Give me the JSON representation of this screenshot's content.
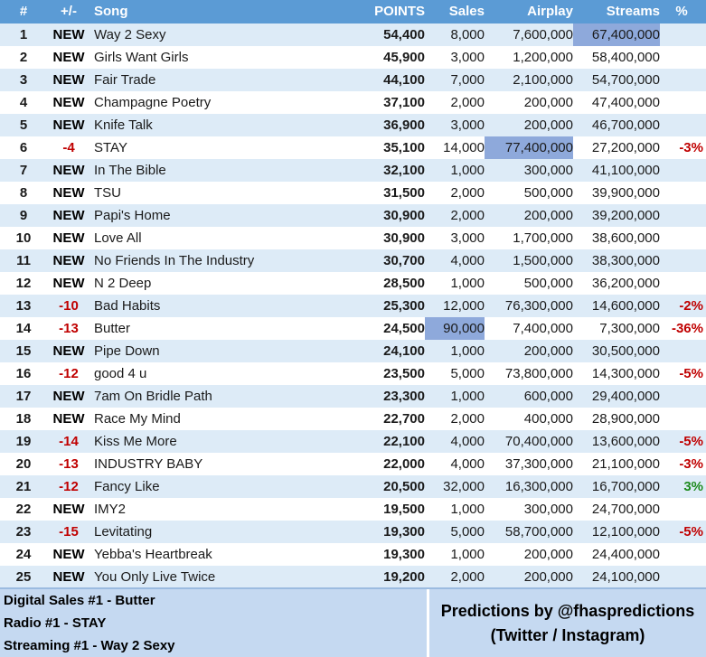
{
  "header": {
    "rank": "#",
    "move": "+/-",
    "song": "Song",
    "points": "POINTS",
    "sales": "Sales",
    "airplay": "Airplay",
    "streams": "Streams",
    "pct": "%"
  },
  "rows": [
    {
      "rank": "1",
      "move": "NEW",
      "song": "Way 2 Sexy",
      "points": "54,400",
      "sales": "8,000",
      "airplay": "7,600,000",
      "streams": "67,400,000",
      "pct": "",
      "hl": "streams"
    },
    {
      "rank": "2",
      "move": "NEW",
      "song": "Girls Want Girls",
      "points": "45,900",
      "sales": "3,000",
      "airplay": "1,200,000",
      "streams": "58,400,000",
      "pct": ""
    },
    {
      "rank": "3",
      "move": "NEW",
      "song": "Fair Trade",
      "points": "44,100",
      "sales": "7,000",
      "airplay": "2,100,000",
      "streams": "54,700,000",
      "pct": ""
    },
    {
      "rank": "4",
      "move": "NEW",
      "song": "Champagne Poetry",
      "points": "37,100",
      "sales": "2,000",
      "airplay": "200,000",
      "streams": "47,400,000",
      "pct": ""
    },
    {
      "rank": "5",
      "move": "NEW",
      "song": "Knife Talk",
      "points": "36,900",
      "sales": "3,000",
      "airplay": "200,000",
      "streams": "46,700,000",
      "pct": ""
    },
    {
      "rank": "6",
      "move": "-4",
      "song": "STAY",
      "points": "35,100",
      "sales": "14,000",
      "airplay": "77,400,000",
      "streams": "27,200,000",
      "pct": "-3%",
      "hl": "airplay"
    },
    {
      "rank": "7",
      "move": "NEW",
      "song": "In The Bible",
      "points": "32,100",
      "sales": "1,000",
      "airplay": "300,000",
      "streams": "41,100,000",
      "pct": ""
    },
    {
      "rank": "8",
      "move": "NEW",
      "song": "TSU",
      "points": "31,500",
      "sales": "2,000",
      "airplay": "500,000",
      "streams": "39,900,000",
      "pct": ""
    },
    {
      "rank": "9",
      "move": "NEW",
      "song": "Papi's Home",
      "points": "30,900",
      "sales": "2,000",
      "airplay": "200,000",
      "streams": "39,200,000",
      "pct": ""
    },
    {
      "rank": "10",
      "move": "NEW",
      "song": "Love All",
      "points": "30,900",
      "sales": "3,000",
      "airplay": "1,700,000",
      "streams": "38,600,000",
      "pct": ""
    },
    {
      "rank": "11",
      "move": "NEW",
      "song": "No Friends In The Industry",
      "points": "30,700",
      "sales": "4,000",
      "airplay": "1,500,000",
      "streams": "38,300,000",
      "pct": ""
    },
    {
      "rank": "12",
      "move": "NEW",
      "song": "N 2 Deep",
      "points": "28,500",
      "sales": "1,000",
      "airplay": "500,000",
      "streams": "36,200,000",
      "pct": ""
    },
    {
      "rank": "13",
      "move": "-10",
      "song": "Bad Habits",
      "points": "25,300",
      "sales": "12,000",
      "airplay": "76,300,000",
      "streams": "14,600,000",
      "pct": "-2%"
    },
    {
      "rank": "14",
      "move": "-13",
      "song": "Butter",
      "points": "24,500",
      "sales": "90,000",
      "airplay": "7,400,000",
      "streams": "7,300,000",
      "pct": "-36%",
      "hl": "sales"
    },
    {
      "rank": "15",
      "move": "NEW",
      "song": "Pipe Down",
      "points": "24,100",
      "sales": "1,000",
      "airplay": "200,000",
      "streams": "30,500,000",
      "pct": ""
    },
    {
      "rank": "16",
      "move": "-12",
      "song": "good 4 u",
      "points": "23,500",
      "sales": "5,000",
      "airplay": "73,800,000",
      "streams": "14,300,000",
      "pct": "-5%"
    },
    {
      "rank": "17",
      "move": "NEW",
      "song": "7am On Bridle Path",
      "points": "23,300",
      "sales": "1,000",
      "airplay": "600,000",
      "streams": "29,400,000",
      "pct": ""
    },
    {
      "rank": "18",
      "move": "NEW",
      "song": "Race My Mind",
      "points": "22,700",
      "sales": "2,000",
      "airplay": "400,000",
      "streams": "28,900,000",
      "pct": ""
    },
    {
      "rank": "19",
      "move": "-14",
      "song": "Kiss Me More",
      "points": "22,100",
      "sales": "4,000",
      "airplay": "70,400,000",
      "streams": "13,600,000",
      "pct": "-5%"
    },
    {
      "rank": "20",
      "move": "-13",
      "song": "INDUSTRY BABY",
      "points": "22,000",
      "sales": "4,000",
      "airplay": "37,300,000",
      "streams": "21,100,000",
      "pct": "-3%"
    },
    {
      "rank": "21",
      "move": "-12",
      "song": "Fancy Like",
      "points": "20,500",
      "sales": "32,000",
      "airplay": "16,300,000",
      "streams": "16,700,000",
      "pct": "3%"
    },
    {
      "rank": "22",
      "move": "NEW",
      "song": "IMY2",
      "points": "19,500",
      "sales": "1,000",
      "airplay": "300,000",
      "streams": "24,700,000",
      "pct": ""
    },
    {
      "rank": "23",
      "move": "-15",
      "song": "Levitating",
      "points": "19,300",
      "sales": "5,000",
      "airplay": "58,700,000",
      "streams": "12,100,000",
      "pct": "-5%"
    },
    {
      "rank": "24",
      "move": "NEW",
      "song": "Yebba's Heartbreak",
      "points": "19,300",
      "sales": "1,000",
      "airplay": "200,000",
      "streams": "24,400,000",
      "pct": ""
    },
    {
      "rank": "25",
      "move": "NEW",
      "song": "You Only Live Twice",
      "points": "19,200",
      "sales": "2,000",
      "airplay": "200,000",
      "streams": "24,100,000",
      "pct": ""
    }
  ],
  "footer": {
    "digital_sales": "Digital Sales #1 - Butter",
    "radio": "Radio #1 - STAY",
    "streaming": "Streaming #1 - Way 2 Sexy",
    "credit_line1": "Predictions by @fhaspredictions",
    "credit_line2": "(Twitter / Instagram)"
  },
  "colors": {
    "header_bg": "#5b9bd5",
    "row_stripe": "#ddebf7",
    "highlight": "#8ea9db",
    "negative": "#c00000",
    "positive": "#1e8a1e"
  }
}
